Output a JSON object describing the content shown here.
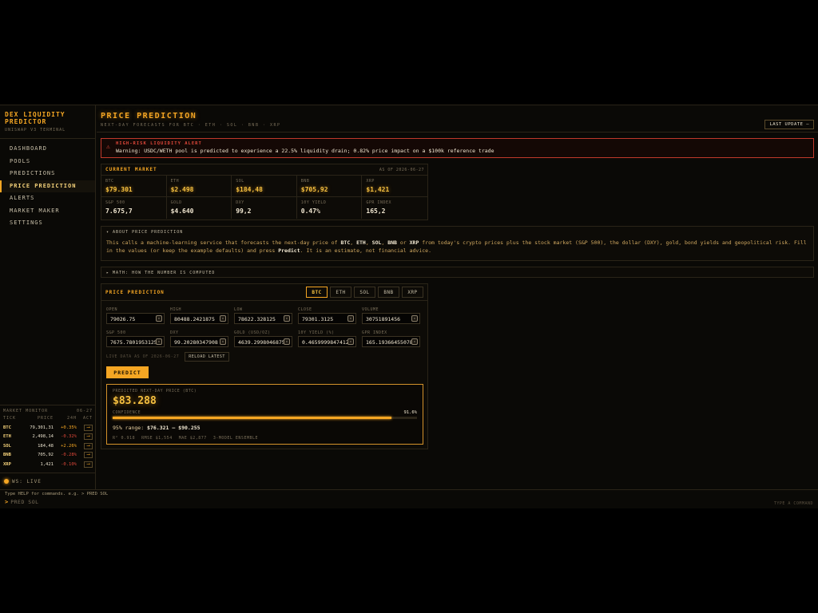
{
  "brand": {
    "title": "DEX LIQUIDITY PREDICTOR",
    "subtitle": "UNISWAP V3 TERMINAL"
  },
  "nav": [
    {
      "label": "DASHBOARD",
      "active": false
    },
    {
      "label": "POOLS",
      "active": false
    },
    {
      "label": "PREDICTIONS",
      "active": false
    },
    {
      "label": "PRICE PREDICTION",
      "active": true
    },
    {
      "label": "ALERTS",
      "active": false
    },
    {
      "label": "MARKET MAKER",
      "active": false
    },
    {
      "label": "SETTINGS",
      "active": false
    }
  ],
  "monitor": {
    "title": "MARKET MONITOR",
    "date": "06-27",
    "cols": {
      "tick": "TICK",
      "price": "PRICE",
      "change": "24H",
      "act": "ACT"
    },
    "rows": [
      {
        "tick": "BTC",
        "price": "79,301,31",
        "change": "+0.35%",
        "dir": "up"
      },
      {
        "tick": "ETH",
        "price": "2,498,14",
        "change": "-0.32%",
        "dir": "down"
      },
      {
        "tick": "SOL",
        "price": "184,48",
        "change": "+2.26%",
        "dir": "up"
      },
      {
        "tick": "BNB",
        "price": "705,92",
        "change": "-0.28%",
        "dir": "down"
      },
      {
        "tick": "XRP",
        "price": "1,421",
        "change": "-0.10%",
        "dir": "down"
      }
    ],
    "act_icon": "⟶"
  },
  "ws_status": "WS: LIVE",
  "header": {
    "title": "PRICE PREDICTION",
    "subtitle": "NEXT-DAY FORECASTS FOR BTC · ETH · SOL · BNB · XRP",
    "last_update": "LAST UPDATE —"
  },
  "alert": {
    "icon": "⚠",
    "title": "HIGH-RISK LIQUIDITY ALERT",
    "message": "Warning: USDC/WETH pool is predicted to experience a 22.5% liquidity drain; 0.82% price impact on a $100k reference trade"
  },
  "market": {
    "title": "CURRENT MARKET",
    "as_of": "AS OF 2026-06-27",
    "cells": [
      {
        "label": "BTC",
        "value": "$79.301",
        "crypto": true
      },
      {
        "label": "ETH",
        "value": "$2.498",
        "crypto": true
      },
      {
        "label": "SOL",
        "value": "$184,48",
        "crypto": true
      },
      {
        "label": "BNB",
        "value": "$705,92",
        "crypto": true
      },
      {
        "label": "XRP",
        "value": "$1,421",
        "crypto": true
      },
      {
        "label": "S&P 500",
        "value": "7.675,7",
        "crypto": false
      },
      {
        "label": "GOLD",
        "value": "$4.640",
        "crypto": false
      },
      {
        "label": "DXY",
        "value": "99,2",
        "crypto": false
      },
      {
        "label": "10Y YIELD",
        "value": "0.47%",
        "crypto": false
      },
      {
        "label": "GPR INDEX",
        "value": "165,2",
        "crypto": false
      }
    ]
  },
  "about": {
    "title": "▾ ABOUT PRICE PREDICTION",
    "t1": "This calls a machine-learning service that forecasts the next-day price of ",
    "b1": "BTC",
    "s1": ", ",
    "b2": "ETH",
    "s2": ", ",
    "b3": "SOL",
    "s3": ", ",
    "b4": "BNB",
    "s4": " or ",
    "b5": "XRP",
    "t2": " from today's crypto prices plus the stock market (S&P 500), the dollar (DXY), gold, bond yields and geopolitical risk. Fill in the values (or keep the example defaults) and press ",
    "b6": "Predict",
    "t3": ". It is an estimate, not financial advice."
  },
  "math": {
    "title": "▸ MATH: HOW THE NUMBER IS COMPUTED"
  },
  "prediction": {
    "title": "PRICE PREDICTION",
    "tabs": [
      {
        "label": "BTC",
        "active": true
      },
      {
        "label": "ETH",
        "active": false
      },
      {
        "label": "SOL",
        "active": false
      },
      {
        "label": "BNB",
        "active": false
      },
      {
        "label": "XRP",
        "active": false
      }
    ],
    "fields_row1": [
      {
        "label": "OPEN",
        "value": "79026.75"
      },
      {
        "label": "HIGH",
        "value": "80488.2421875"
      },
      {
        "label": "LOW",
        "value": "78622.328125"
      },
      {
        "label": "CLOSE",
        "value": "79301.3125"
      },
      {
        "label": "VOLUME",
        "value": "30751891456"
      }
    ],
    "fields_row2": [
      {
        "label": "S&P 500",
        "value": "7675.7801953125"
      },
      {
        "label": "DXY",
        "value": "99.20280347908"
      },
      {
        "label": "GOLD (USD/OZ)",
        "value": "4639.2998046875"
      },
      {
        "label": "10Y YIELD (%)",
        "value": "0.46599998474121"
      },
      {
        "label": "GPR INDEX",
        "value": "165.19366455078"
      }
    ],
    "live_text": "LIVE DATA AS OF 2026-06-27",
    "reload_label": "RELOAD LATEST",
    "predict_label": "PREDICT",
    "result": {
      "label": "PREDICTED NEXT-DAY PRICE (BTC)",
      "price": "$83.288",
      "confidence_label": "CONFIDENCE",
      "confidence_value": "91.6%",
      "confidence": 0.916,
      "range_label": "95% range: ",
      "range_value": "$76.321 – $90.255",
      "metrics": [
        "R² 0.918",
        "RMSE $1,554",
        "MAE $2,877",
        "3-MODEL ENSEMBLE"
      ]
    }
  },
  "command": {
    "help": "Type HELP for commands. e.g. > PRED SOL",
    "prompt": ">",
    "input": "PRED SOL",
    "hint": "TYPE A COMMAND"
  }
}
